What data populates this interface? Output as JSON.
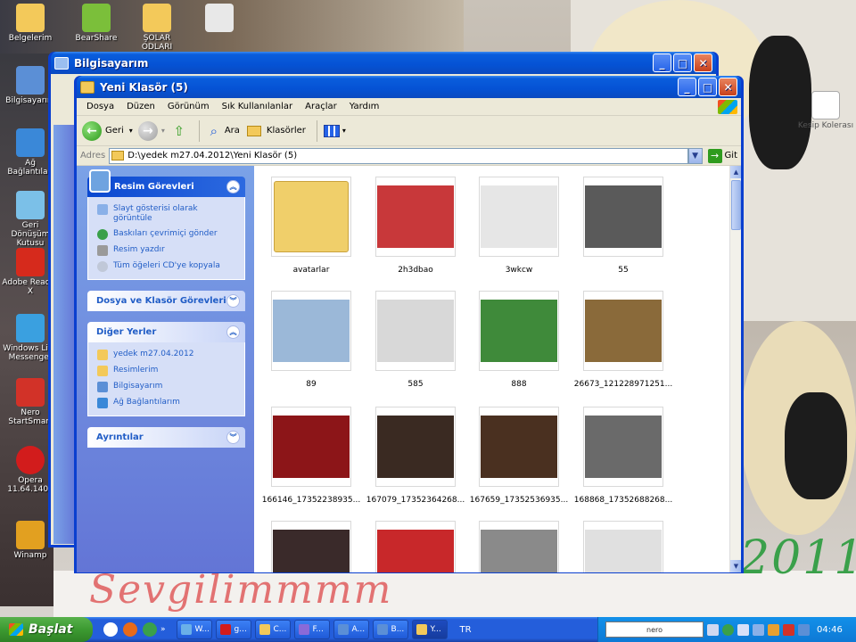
{
  "desktop": {
    "icons": [
      {
        "name": "belgelerim",
        "label": "Belgelerim",
        "color": "#f3c95a"
      },
      {
        "name": "bearshare",
        "label": "BearShare",
        "color": "#7bbf3a"
      },
      {
        "name": "sarkilar",
        "label": "ŞOLAR ODLARI",
        "color": "#f3c95a"
      },
      {
        "name": "file-top",
        "label": "",
        "color": "#e8e8e8"
      },
      {
        "name": "bilgisayarim",
        "label": "Bilgisayarım",
        "color": "#5b8fd6"
      },
      {
        "name": "ag-baglantilari",
        "label": "Ağ Bağlantıları",
        "color": "#3a88d8"
      },
      {
        "name": "geri-donusum",
        "label": "Geri Dönüşüm Kutusu",
        "color": "#7bc0e8"
      },
      {
        "name": "adobe-reader",
        "label": "Adobe Reader X",
        "color": "#d62a1c"
      },
      {
        "name": "messenger",
        "label": "Windows Live Messenger",
        "color": "#3aa0e0"
      },
      {
        "name": "nero",
        "label": "Nero StartSmart",
        "color": "#d23228"
      },
      {
        "name": "opera",
        "label": "Opera 11.64.1403",
        "color": "#d21c1c"
      },
      {
        "name": "winamp",
        "label": "Winamp",
        "color": "#e2a020"
      },
      {
        "name": "kesip-kolerasi",
        "label": "Kesip Kolerası",
        "color": "#ffffff"
      }
    ],
    "wallpaper_text_left": "Sevgilimmmm",
    "wallpaper_text_right": "2011"
  },
  "back_window": {
    "title": "Bilgisayarım"
  },
  "window": {
    "title": "Yeni Klasör (5)",
    "menu": [
      "Dosya",
      "Düzen",
      "Görünüm",
      "Sık Kullanılanlar",
      "Araçlar",
      "Yardım"
    ],
    "toolbar": {
      "back_label": "Geri",
      "search_label": "Ara",
      "folders_label": "Klasörler"
    },
    "address": {
      "label": "Adres",
      "value": "D:\\yedek m27.04.2012\\Yeni Klasör (5)",
      "go_label": "Git"
    },
    "taskpane": {
      "picture_tasks": {
        "title": "Resim Görevleri",
        "items": [
          "Slayt gösterisi olarak görüntüle",
          "Baskıları çevrimiçi gönder",
          "Resim yazdır",
          "Tüm öğeleri CD'ye kopyala"
        ]
      },
      "file_tasks": {
        "title": "Dosya ve Klasör Görevleri"
      },
      "other_places": {
        "title": "Diğer Yerler",
        "items": [
          "yedek m27.04.2012",
          "Resimlerim",
          "Bilgisayarım",
          "Ağ Bağlantılarım"
        ]
      },
      "details": {
        "title": "Ayrıntılar"
      }
    },
    "files": [
      {
        "name": "avatarlar",
        "kind": "folder",
        "color": "#f0cf6a"
      },
      {
        "name": "2h3dbao",
        "kind": "image",
        "color": "#c8383a"
      },
      {
        "name": "3wkcw",
        "kind": "image",
        "color": "#e6e6e6"
      },
      {
        "name": "55",
        "kind": "image",
        "color": "#5a5a5a"
      },
      {
        "name": "89",
        "kind": "image",
        "color": "#9bb8d8"
      },
      {
        "name": "585",
        "kind": "image",
        "color": "#d8d8d8"
      },
      {
        "name": "888",
        "kind": "image",
        "color": "#3f8a3a"
      },
      {
        "name": "26673_121228971251...",
        "kind": "image",
        "color": "#8a6a3a"
      },
      {
        "name": "166146_17352238935...",
        "kind": "image",
        "color": "#8c1518"
      },
      {
        "name": "167079_17352364268...",
        "kind": "image",
        "color": "#3a2a22"
      },
      {
        "name": "167659_17352536935...",
        "kind": "image",
        "color": "#4a3020"
      },
      {
        "name": "168868_17352688268...",
        "kind": "image",
        "color": "#6a6a6a"
      },
      {
        "name": "",
        "kind": "image",
        "color": "#3a2a2a"
      },
      {
        "name": "",
        "kind": "image",
        "color": "#c8282a"
      },
      {
        "name": "",
        "kind": "image",
        "color": "#8a8a8a"
      },
      {
        "name": "",
        "kind": "image",
        "color": "#e0e0e0"
      }
    ]
  },
  "taskbar": {
    "start_label": "Başlat",
    "tasks": [
      {
        "label": "W...",
        "color": "#6ab0e8"
      },
      {
        "label": "g...",
        "color": "#d21c1c"
      },
      {
        "label": "C...",
        "color": "#f3c95a"
      },
      {
        "label": "F...",
        "color": "#8a6ad8"
      },
      {
        "label": "A...",
        "color": "#5b8fd6"
      },
      {
        "label": "B...",
        "color": "#5b8fd6"
      },
      {
        "label": "Y...",
        "color": "#f3c95a",
        "active": true
      }
    ],
    "language": "TR",
    "tray_box": "nero",
    "clock": "04:46"
  }
}
